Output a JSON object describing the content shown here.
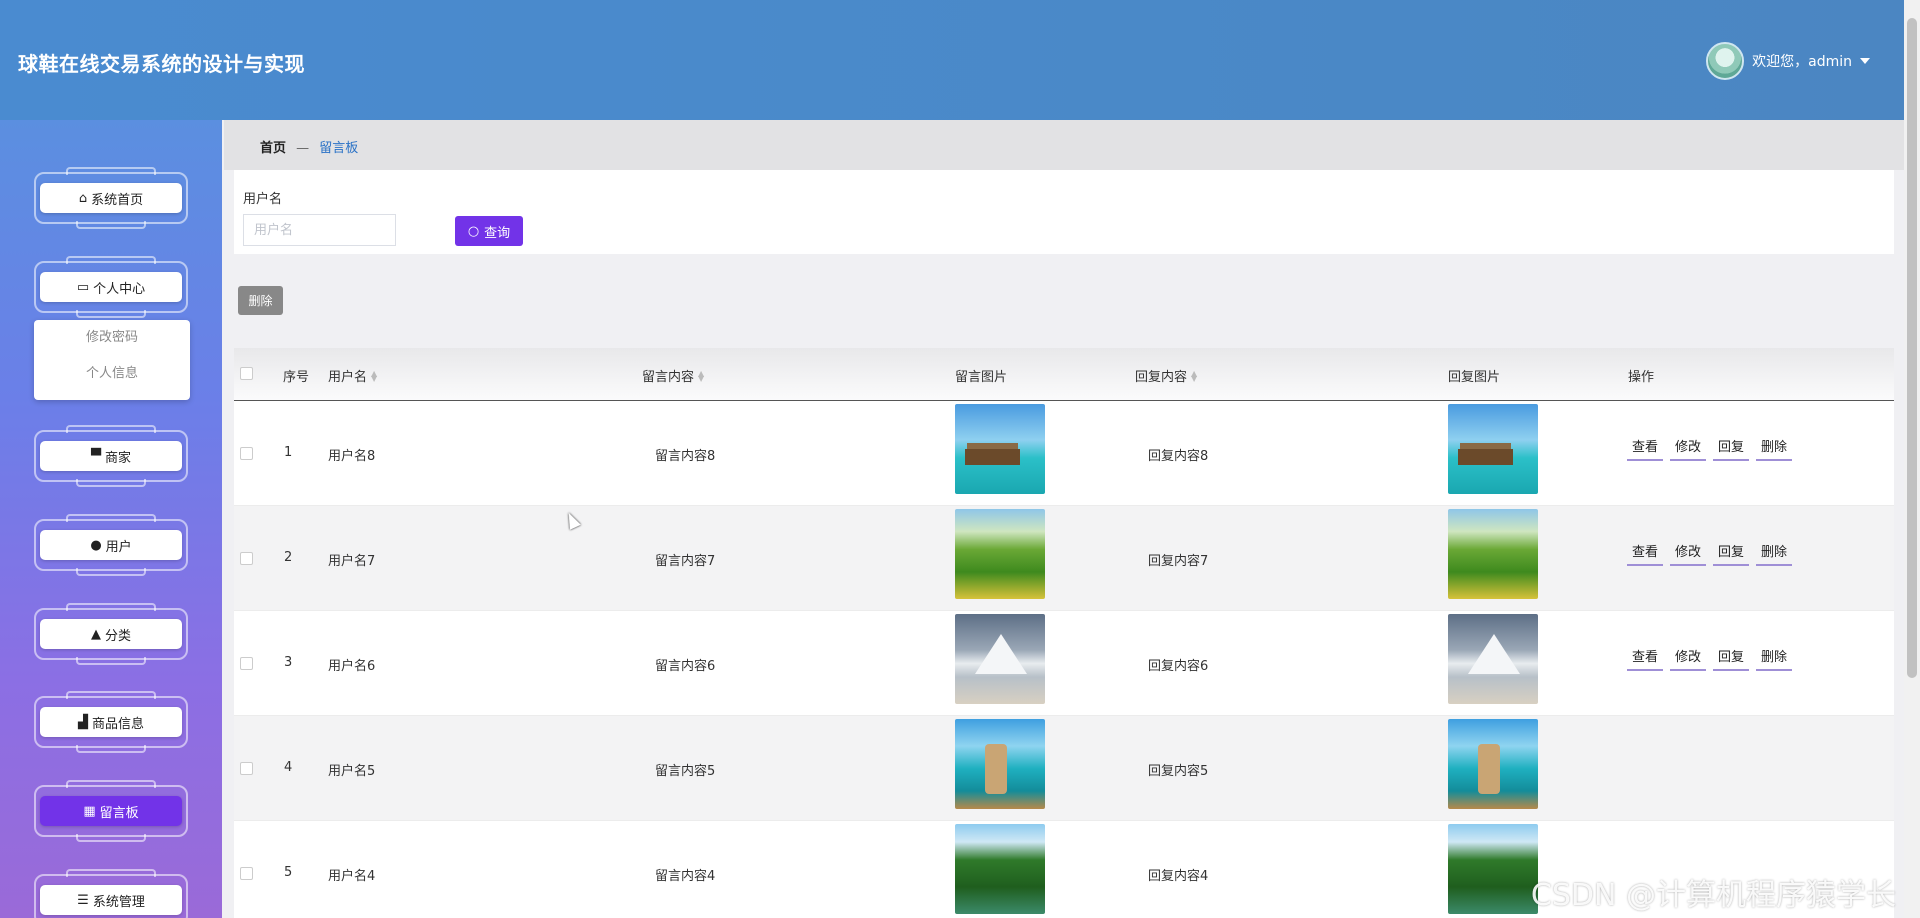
{
  "header": {
    "title": "球鞋在线交易系统的设计与实现",
    "welcome_text": "欢迎您，admin"
  },
  "sidebar": {
    "items": [
      {
        "label": "系统首页",
        "icon": "home-icon"
      },
      {
        "label": "个人中心",
        "icon": "card-icon"
      },
      {
        "label": "商家",
        "icon": "monitor-icon"
      },
      {
        "label": "用户",
        "icon": "bulb-icon"
      },
      {
        "label": "分类",
        "icon": "user-icon"
      },
      {
        "label": "商品信息",
        "icon": "thumb-icon"
      },
      {
        "label": "留言板",
        "icon": "grid-icon"
      },
      {
        "label": "系统管理",
        "icon": "list-icon"
      }
    ],
    "submenu": [
      "修改密码",
      "个人信息"
    ],
    "active_item": "留言板"
  },
  "breadcrumb": {
    "home": "首页",
    "separator": "—",
    "current": "留言板"
  },
  "search": {
    "label": "用户名",
    "placeholder": "用户名",
    "button_label": "查询"
  },
  "toolbar": {
    "delete_label": "删除"
  },
  "table": {
    "columns": [
      "序号",
      "用户名",
      "留言内容",
      "留言图片",
      "回复内容",
      "回复图片",
      "操作"
    ],
    "rows": [
      {
        "index": "1",
        "username": "用户名8",
        "content": "留言内容8",
        "reply": "回复内容8",
        "image": "beach"
      },
      {
        "index": "2",
        "username": "用户名7",
        "content": "留言内容7",
        "reply": "回复内容7",
        "image": "hills"
      },
      {
        "index": "3",
        "username": "用户名6",
        "content": "留言内容6",
        "reply": "回复内容6",
        "image": "mountain"
      },
      {
        "index": "4",
        "username": "用户名5",
        "content": "留言内容5",
        "reply": "回复内容5",
        "image": "rocks"
      },
      {
        "index": "5",
        "username": "用户名4",
        "content": "留言内容4",
        "reply": "回复内容4",
        "image": "forest"
      }
    ],
    "actions": [
      "查看",
      "修改",
      "回复",
      "删除"
    ]
  },
  "watermark": "CSDN @计算机程序猿学长",
  "colors": {
    "header": "#4a8bd0",
    "accent": "#7233e8",
    "breadcrumb_link": "#2a72c6"
  }
}
